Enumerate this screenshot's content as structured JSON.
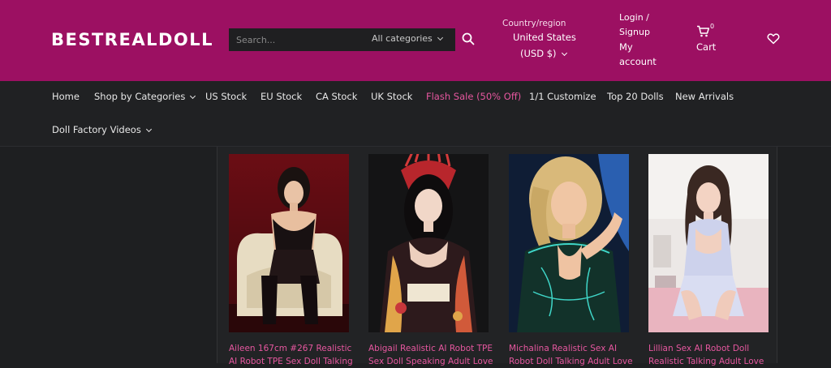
{
  "header": {
    "logo": "BESTREALDOLL",
    "search_placeholder": "Search...",
    "category_select": "All categories",
    "region_label": "Country/region",
    "region_country": "United States",
    "region_currency": "(USD $)",
    "login_line1": "Login /",
    "login_line2": "Signup",
    "account_line1": "My",
    "account_line2": "account",
    "cart_count": "0",
    "cart_label": "Cart",
    "brand_color": "#9c1062",
    "accent_color": "#e6579f"
  },
  "nav": {
    "items": [
      {
        "label": "Home"
      },
      {
        "label": "Shop by Categories"
      },
      {
        "label": "US Stock"
      },
      {
        "label": "EU Stock"
      },
      {
        "label": "CA Stock"
      },
      {
        "label": "UK Stock"
      },
      {
        "label": "Flash Sale (50% Off)"
      },
      {
        "label": "1/1 Customize"
      },
      {
        "label": "Top 20 Dolls"
      },
      {
        "label": "New Arrivals"
      },
      {
        "label": "Doll Factory Videos"
      }
    ]
  },
  "products": [
    {
      "title_line1": "Aileen 167cm #267 Realistic",
      "title_line2": "AI Robot TPE Sex Doll Talking"
    },
    {
      "title_line1": "Abigail Realistic AI Robot TPE",
      "title_line2": "Sex Doll Speaking Adult Love"
    },
    {
      "title_line1": "Michalina Realistic Sex AI",
      "title_line2": "Robot Doll Talking Adult Love"
    },
    {
      "title_line1": "Lillian Sex AI Robot Doll",
      "title_line2": "Realistic Talking Adult Love"
    }
  ]
}
